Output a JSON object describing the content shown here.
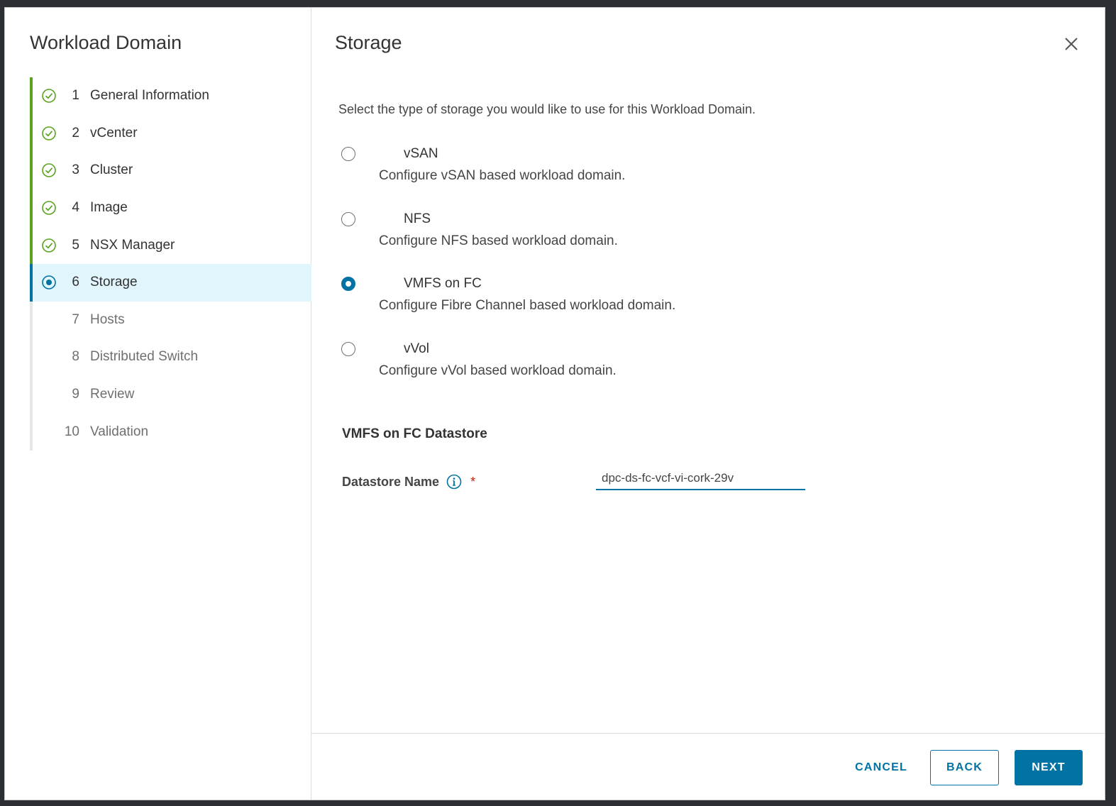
{
  "wizard": {
    "title": "Workload Domain",
    "steps": [
      {
        "num": "1",
        "label": "General Information",
        "state": "done"
      },
      {
        "num": "2",
        "label": "vCenter",
        "state": "done"
      },
      {
        "num": "3",
        "label": "Cluster",
        "state": "done"
      },
      {
        "num": "4",
        "label": "Image",
        "state": "done"
      },
      {
        "num": "5",
        "label": "NSX Manager",
        "state": "done"
      },
      {
        "num": "6",
        "label": "Storage",
        "state": "current"
      },
      {
        "num": "7",
        "label": "Hosts",
        "state": "todo"
      },
      {
        "num": "8",
        "label": "Distributed Switch",
        "state": "todo"
      },
      {
        "num": "9",
        "label": "Review",
        "state": "todo"
      },
      {
        "num": "10",
        "label": "Validation",
        "state": "todo"
      }
    ]
  },
  "page": {
    "title": "Storage",
    "intro": "Select the type of storage you would like to use for this Workload Domain.",
    "storage_options": [
      {
        "label": "vSAN",
        "description": "Configure vSAN based workload domain.",
        "checked": false
      },
      {
        "label": "NFS",
        "description": "Configure NFS based workload domain.",
        "checked": false
      },
      {
        "label": "VMFS on FC",
        "description": "Configure Fibre Channel based workload domain.",
        "checked": true
      },
      {
        "label": "vVol",
        "description": "Configure vVol based workload domain.",
        "checked": false
      }
    ],
    "section_title": "VMFS on FC Datastore",
    "datastore_field": {
      "label": "Datastore Name",
      "required_mark": "*",
      "value": "dpc-ds-fc-vcf-vi-cork-29v"
    }
  },
  "footer": {
    "cancel_label": "CANCEL",
    "back_label": "BACK",
    "next_label": "NEXT"
  },
  "colors": {
    "accent": "#0072a3",
    "done": "#5aa220",
    "current_bg": "#e1f5fc",
    "required": "#c21d00"
  },
  "icons": {
    "done": "check-circle-icon",
    "current": "dot-circle-icon",
    "close": "close-icon",
    "info": "info-circle-icon"
  }
}
